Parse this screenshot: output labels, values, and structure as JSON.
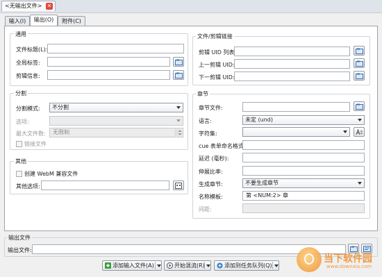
{
  "window": {
    "doc_tab_title": "<无输出文件>",
    "close_glyph": "✕"
  },
  "tabs": [
    {
      "label": "输入(I)",
      "active": false
    },
    {
      "label": "输出(O)",
      "active": true
    },
    {
      "label": "附件(C)",
      "active": false
    }
  ],
  "general": {
    "title": "通用",
    "file_title_label": "文件标题(L):",
    "file_title_value": "",
    "global_tags_label": "全局标签:",
    "global_tags_value": "",
    "segment_info_label": "剪辑信息:",
    "segment_info_value": ""
  },
  "split": {
    "title": "分割",
    "mode_label": "分割模式:",
    "mode_value": "不分割",
    "options_label": "选项:",
    "options_value": "",
    "max_files_label": "最大文件数:",
    "max_files_value": "无限制",
    "link_files_label": "链接文件",
    "link_files_checked": false
  },
  "misc": {
    "title": "其他",
    "webm_label": "创建 WebM 兼容文件",
    "webm_checked": false,
    "other_options_label": "其他选项:",
    "other_options_value": ""
  },
  "linking": {
    "title": "文件/剪辑链接",
    "uids_label": "剪辑 UID 列表:",
    "uids_value": "",
    "prev_uid_label": "上一剪辑 UID:",
    "prev_uid_value": "",
    "next_uid_label": "下一剪辑 UID:",
    "next_uid_value": ""
  },
  "chapters": {
    "title": "章节",
    "file_label": "章节文件:",
    "file_value": "",
    "language_label": "语言:",
    "language_value": "未定 (und)",
    "charset_label": "字符集:",
    "charset_value": "",
    "cue_label": "cue 表单命名格式:",
    "cue_value": "",
    "delay_label": "延迟 (毫秒):",
    "delay_value": "",
    "stretch_label": "伸展比率:",
    "stretch_value": "",
    "generate_label": "生成章节:",
    "generate_value": "不要生成章节",
    "name_template_label": "名称模板:",
    "name_template_value": "第 <NUM:2> 章",
    "interval_label": "间距:",
    "interval_value": ""
  },
  "output": {
    "title": "输出文件",
    "file_label": "输出文件:",
    "file_value": ""
  },
  "bottom_buttons": {
    "add_input": "添加输入文件(A)",
    "start_mux": "开始混流(R)",
    "add_queue": "添加到任务队列(Q)"
  },
  "watermark": {
    "text": "当下软件园",
    "url": "www.downxia.com"
  },
  "colors": {
    "accent_blue": "#1f6fc4",
    "close_red": "#e0493b",
    "watermark_orange": "#f08a24"
  },
  "icons": {
    "browse": "folder-browse-icon",
    "font": "font-icon",
    "options": "options-dialog-icon",
    "add": "plus-icon",
    "play": "play-icon",
    "queue": "queue-add-icon"
  }
}
